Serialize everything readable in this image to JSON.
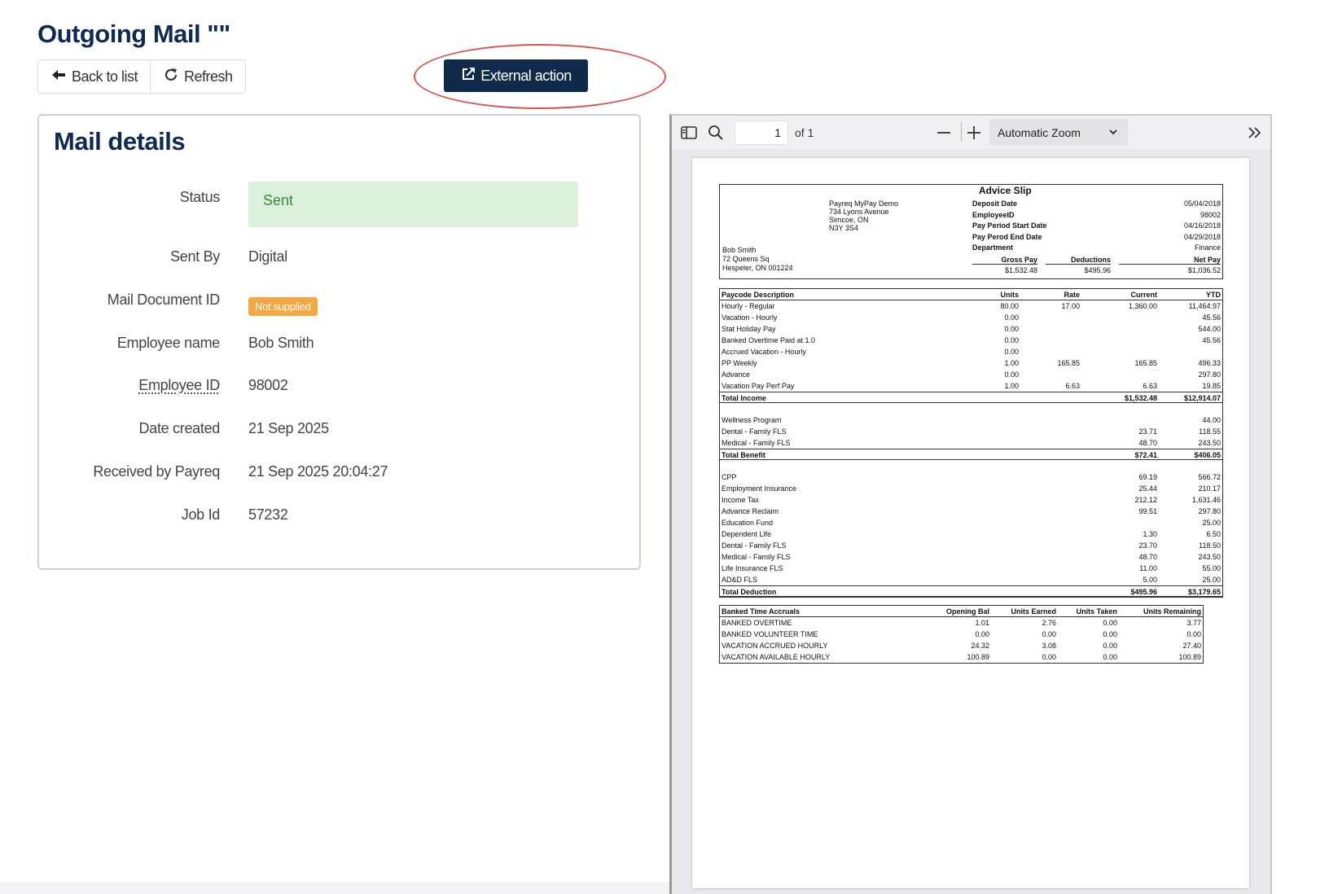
{
  "page": {
    "title": "Outgoing Mail \"\""
  },
  "toolbar": {
    "back_label": "Back to list",
    "refresh_label": "Refresh",
    "external_label": "External action"
  },
  "details": {
    "title": "Mail details",
    "status_label": "Status",
    "status_value": "Sent",
    "sent_by_label": "Sent By",
    "sent_by_value": "Digital",
    "doc_id_label": "Mail Document ID",
    "doc_id_value": "Not supplied",
    "employee_name_label": "Employee name",
    "employee_name_value": "Bob Smith",
    "employee_id_label": "Employee ID",
    "employee_id_value": "98002",
    "date_created_label": "Date created",
    "date_created_value": "21 Sep 2025",
    "received_label": "Received by Payreq",
    "received_value": "21 Sep 2025 20:04:27",
    "job_id_label": "Job Id",
    "job_id_value": "57232"
  },
  "viewer": {
    "page_number": "1",
    "page_of": "of 1",
    "zoom": "Automatic Zoom"
  },
  "slip": {
    "title": "Advice Slip",
    "company": [
      "Payreq MyPay Demo",
      "734  Lyons Avenue",
      "Simcoe, ON",
      "N3Y 3S4"
    ],
    "employee": [
      "Bob Smith",
      "72  Queens Sq",
      "Hespeler, ON  001224"
    ],
    "fields": [
      {
        "label": "Deposit Date",
        "value": "05/04/2018"
      },
      {
        "label": "EmployeeID",
        "value": "98002"
      },
      {
        "label": "Pay Period Start Date",
        "value": "04/16/2018"
      },
      {
        "label": "Pay Perod End Date",
        "value": "04/29/2018"
      },
      {
        "label": "Department",
        "value": "Finance"
      }
    ],
    "gross_label": "Gross Pay",
    "gross_value": "$1,532.48",
    "deductions_label": "Deductions",
    "deductions_value": "$495.96",
    "net_label": "Net Pay",
    "net_value": "$1,036.52"
  },
  "paycodes": {
    "headers": [
      "Paycode Description",
      "Units",
      "Rate",
      "Current",
      "YTD"
    ],
    "rows": [
      [
        "Hourly - Regular",
        "80.00",
        "17.00",
        "1,360.00",
        "11,464.97"
      ],
      [
        "Vacation - Hourly",
        "0.00",
        "",
        "",
        "45.56"
      ],
      [
        "Stat Holiday Pay",
        "0.00",
        "",
        "",
        "544.00"
      ],
      [
        "Banked Overtime Paid at 1.0",
        "0.00",
        "",
        "",
        "45.56"
      ],
      [
        "Accrued Vacation - Hourly",
        "0.00",
        "",
        "",
        ""
      ],
      [
        "PP Weekly",
        "1.00",
        "165.85",
        "165.85",
        "496.33"
      ],
      [
        "Advance",
        "0.00",
        "",
        "",
        "297.80"
      ],
      [
        "Vacation Pay Perf Pay",
        "1.00",
        "6.63",
        "6.63",
        "19.85"
      ]
    ],
    "total_income": [
      "Total Income",
      "",
      "",
      "$1,532.48",
      "$12,914.07"
    ],
    "benefits": [
      [
        "Wellness Program",
        "",
        "",
        "",
        "44.00"
      ],
      [
        "Dental - Family FLS",
        "",
        "",
        "23.71",
        "118.55"
      ],
      [
        "Medical - Family FLS",
        "",
        "",
        "48.70",
        "243.50"
      ]
    ],
    "total_benefit": [
      "Total Benefit",
      "",
      "",
      "$72.41",
      "$406.05"
    ],
    "deductions": [
      [
        "CPP",
        "",
        "",
        "69.19",
        "566.72"
      ],
      [
        "Employment Insurance",
        "",
        "",
        "25.44",
        "210.17"
      ],
      [
        "Income Tax",
        "",
        "",
        "212.12",
        "1,631.46"
      ],
      [
        "Advance Reclaim",
        "",
        "",
        "99.51",
        "297.80"
      ],
      [
        "Education Fund",
        "",
        "",
        "",
        "25.00"
      ],
      [
        "Dependent Life",
        "",
        "",
        "1.30",
        "6.50"
      ],
      [
        "Dental - Family FLS",
        "",
        "",
        "23.70",
        "118.50"
      ],
      [
        "Medical - Family FLS",
        "",
        "",
        "48.70",
        "243.50"
      ],
      [
        "Life Insurance FLS",
        "",
        "",
        "11.00",
        "55.00"
      ],
      [
        "AD&D FLS",
        "",
        "",
        "5.00",
        "25.00"
      ]
    ],
    "total_deduction": [
      "Total Deduction",
      "",
      "",
      "$495.96",
      "$3,179.65"
    ]
  },
  "accruals": {
    "headers": [
      "Banked Time Accruals",
      "Opening Bal",
      "Units Earned",
      "Units Taken",
      "Units Remaining"
    ],
    "rows": [
      [
        "BANKED OVERTIME",
        "1.01",
        "2.76",
        "0.00",
        "3.77"
      ],
      [
        "BANKED VOLUNTEER TIME",
        "0.00",
        "0.00",
        "0.00",
        "0.00"
      ],
      [
        "VACATION ACCRUED HOURLY",
        "24.32",
        "3.08",
        "0.00",
        "27.40"
      ],
      [
        "VACATION AVAILABLE HOURLY",
        "100.89",
        "0.00",
        "0.00",
        "100.89"
      ]
    ]
  },
  "colors": {
    "primary": "#0f2a4a",
    "status_bg": "#daf1da",
    "status_text": "#3d8a3d",
    "badge": "#f5a742",
    "highlight": "#d9534f"
  }
}
